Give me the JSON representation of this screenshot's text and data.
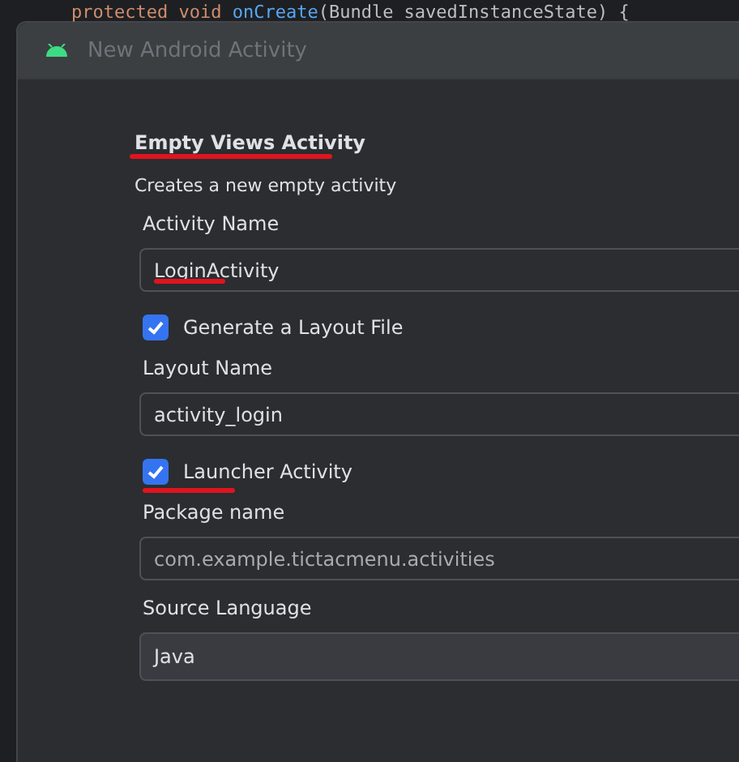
{
  "editor": {
    "code_line": [
      {
        "text": "protected void ",
        "kind": "keyword"
      },
      {
        "text": "onCreate",
        "kind": "method"
      },
      {
        "text": "(Bundle savedInstanceState) {",
        "kind": "plain"
      }
    ]
  },
  "window": {
    "title": "New Android Activity"
  },
  "template": {
    "title": "Empty Views Activity",
    "underlined": true,
    "description": "Creates a new empty activity"
  },
  "form": [
    {
      "kind": "text",
      "label": "Activity Name",
      "value": "LoginActivity",
      "underlined": true,
      "disabled": false
    },
    {
      "kind": "checkbox",
      "label": "Generate a Layout File",
      "checked": true,
      "underlined": false
    },
    {
      "kind": "text",
      "label": "Layout Name",
      "value": "activity_login",
      "underlined": false,
      "disabled": false
    },
    {
      "kind": "checkbox",
      "label": "Launcher Activity",
      "checked": true,
      "underlined": true
    },
    {
      "kind": "text",
      "label": "Package name",
      "value": "com.example.tictacmenu.activities",
      "underlined": false,
      "disabled": true
    },
    {
      "kind": "dropdown",
      "label": "Source Language",
      "value": "Java"
    }
  ]
}
